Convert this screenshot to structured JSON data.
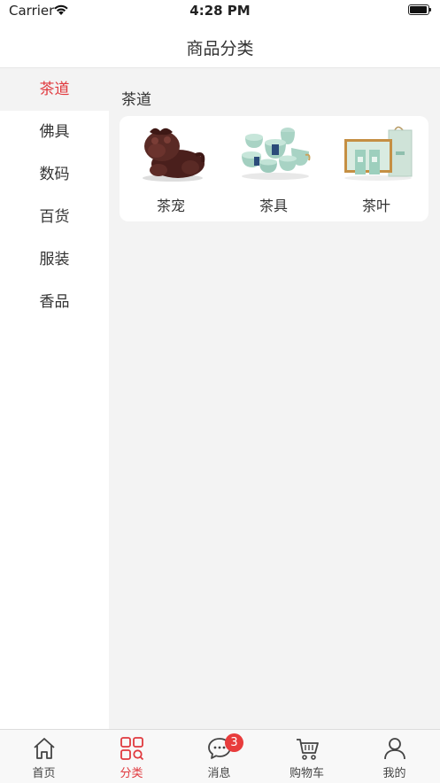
{
  "status_bar": {
    "carrier": "Carrier",
    "time": "4:28 PM"
  },
  "nav": {
    "title": "商品分类"
  },
  "sidebar": {
    "items": [
      {
        "label": "茶道",
        "active": true
      },
      {
        "label": "佛具"
      },
      {
        "label": "数码"
      },
      {
        "label": "百货"
      },
      {
        "label": "服装"
      },
      {
        "label": "香品"
      }
    ]
  },
  "content": {
    "section_title": "茶道",
    "products": [
      {
        "label": "茶宠",
        "icon": "tea-pet-figurine-image"
      },
      {
        "label": "茶具",
        "icon": "tea-set-image"
      },
      {
        "label": "茶叶",
        "icon": "tea-leaves-gift-box-image"
      }
    ]
  },
  "tabbar": {
    "tabs": [
      {
        "label": "首页",
        "icon": "home-icon"
      },
      {
        "label": "分类",
        "icon": "category-icon",
        "active": true
      },
      {
        "label": "消息",
        "icon": "message-icon",
        "badge": "3"
      },
      {
        "label": "购物车",
        "icon": "cart-icon"
      },
      {
        "label": "我的",
        "icon": "profile-icon"
      }
    ]
  },
  "colors": {
    "accent": "#e0393e",
    "badge": "#e83c3c",
    "content_bg": "#f3f3f3"
  }
}
